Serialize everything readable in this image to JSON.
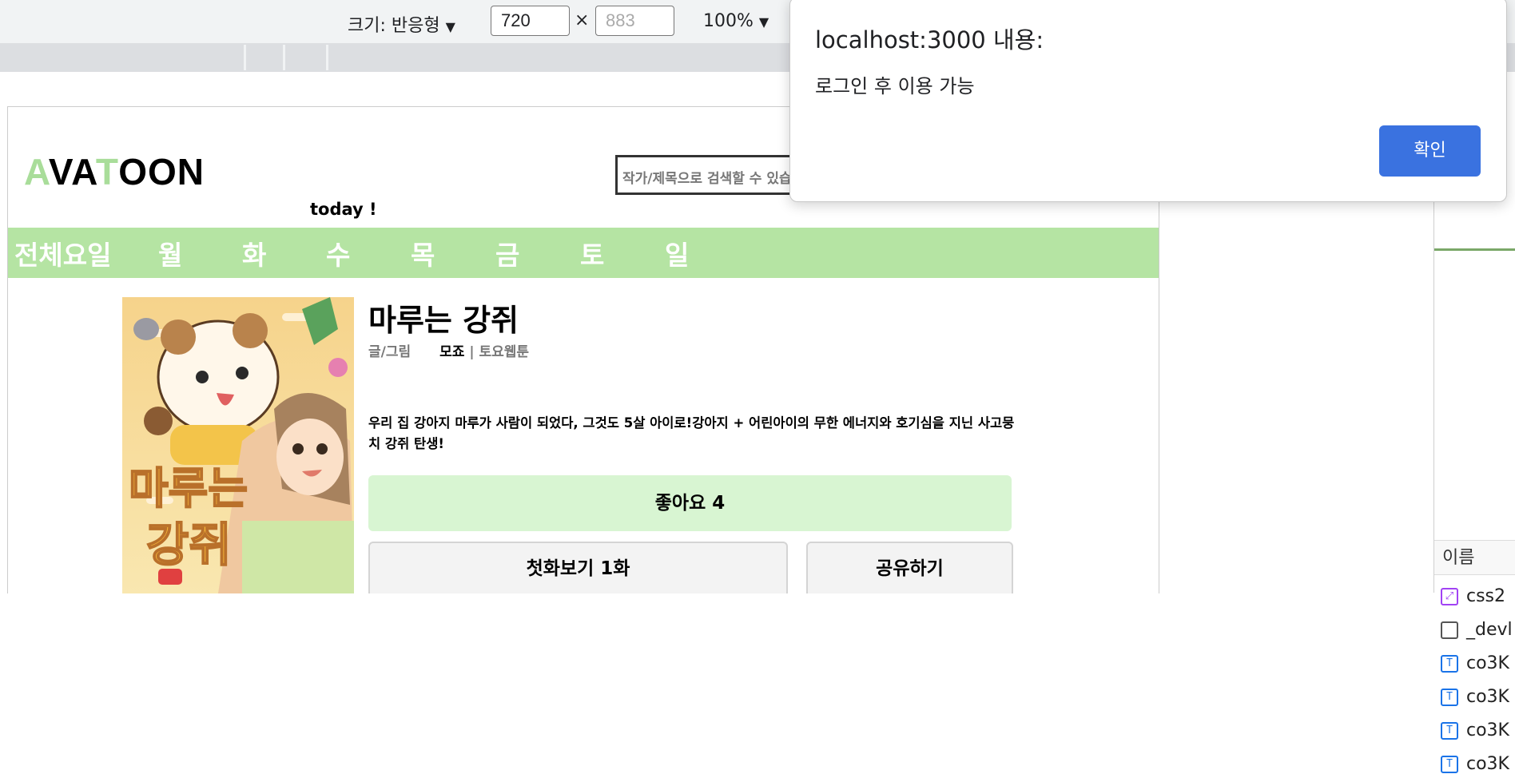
{
  "devtools": {
    "size_label": "크기: 반응형",
    "width_value": "720",
    "height_placeholder": "883",
    "times_sign": "×",
    "zoom": "100%",
    "panel_header": "이름",
    "files": [
      "css2",
      "_devl",
      "co3K",
      "co3K",
      "co3K",
      "co3K"
    ]
  },
  "site": {
    "logo": {
      "a": "A",
      "v": "V",
      "a2": "A",
      "t": "T",
      "rest": "OON"
    },
    "search_placeholder": "작가/제목으로 검색할 수 있습",
    "today": "today !",
    "days": [
      "전체요일",
      "월",
      "화",
      "수",
      "목",
      "금",
      "토",
      "일"
    ]
  },
  "webtoon": {
    "title": "마루는 강쥐",
    "credit_label": "글/그림",
    "author": "모죠",
    "separator": "|",
    "category": "토요웹툰",
    "description": "우리 집 강아지 마루가 사람이 되었다, 그것도 5살 아이로!강아지 + 어린아이의 무한 에너지와 호기심을 지닌 사고뭉치 강쥐 탄생!",
    "like_label": "좋아요 4",
    "first_episode_label": "첫화보기 1화",
    "share_label": "공유하기",
    "cover_title": "마루는 강쥐"
  },
  "dialog": {
    "title": "localhost:3000 내용:",
    "message": "로그인 후 이용 가능",
    "ok_label": "확인"
  },
  "colors": {
    "nav": "#b5e4a3",
    "logo_accent": "#a9dd9a",
    "like_bg": "#d8f5d2",
    "dialog_button": "#3a72e0"
  }
}
